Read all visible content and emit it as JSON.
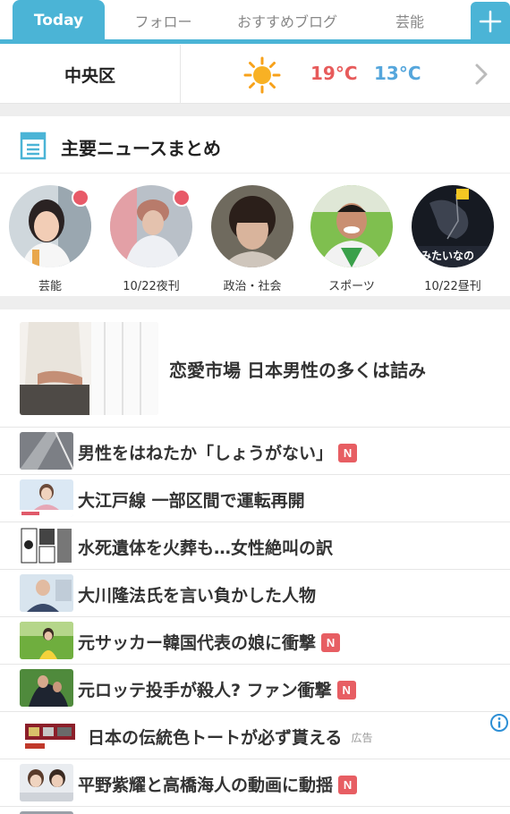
{
  "tabs": [
    {
      "label": "Today",
      "active": true
    },
    {
      "label": "フォロー",
      "active": false
    },
    {
      "label": "おすすめブログ",
      "active": false
    },
    {
      "label": "芸能",
      "active": false
    }
  ],
  "add_tab_icon": "plus-icon",
  "weather": {
    "area": "中央区",
    "icon": "sun-icon",
    "high": "19°C",
    "low": "13°C",
    "high_color": "#e75b5b",
    "low_color": "#55a6dc"
  },
  "summary": {
    "title": "主要ニュースまとめ",
    "icon": "news-list-icon",
    "stories": [
      {
        "label": "芸能",
        "unread": true
      },
      {
        "label": "10/22夜刊",
        "unread": true
      },
      {
        "label": "政治・社会",
        "unread": false
      },
      {
        "label": "スポーツ",
        "unread": false
      },
      {
        "label": "10/22昼刊",
        "unread": false,
        "overlay_text": "みたいなの"
      }
    ]
  },
  "headline": {
    "text": "恋愛市場 日本男性の多くは詰み"
  },
  "news": [
    {
      "text": "男性をはねたか「しょうがない」",
      "badge": "N"
    },
    {
      "text": "大江戸線 一部区間で運転再開",
      "badge": ""
    },
    {
      "text": "水死遺体を火葬も…女性絶叫の訳",
      "badge": ""
    },
    {
      "text": "大川隆法氏を言い負かした人物",
      "badge": ""
    },
    {
      "text": "元サッカー韓国代表の娘に衝撃",
      "badge": "N"
    },
    {
      "text": "元ロッテ投手が殺人? ファン衝撃",
      "badge": "N"
    },
    {
      "text": "日本の伝統色トートが必ず貰える",
      "ad_label": "広告"
    },
    {
      "text": "平野紫耀と高橋海人の動画に動揺",
      "badge": "N"
    }
  ],
  "colors": {
    "accent": "#4bb4d6",
    "badge": "#e75e63",
    "unread_dot": "#e85a68"
  }
}
